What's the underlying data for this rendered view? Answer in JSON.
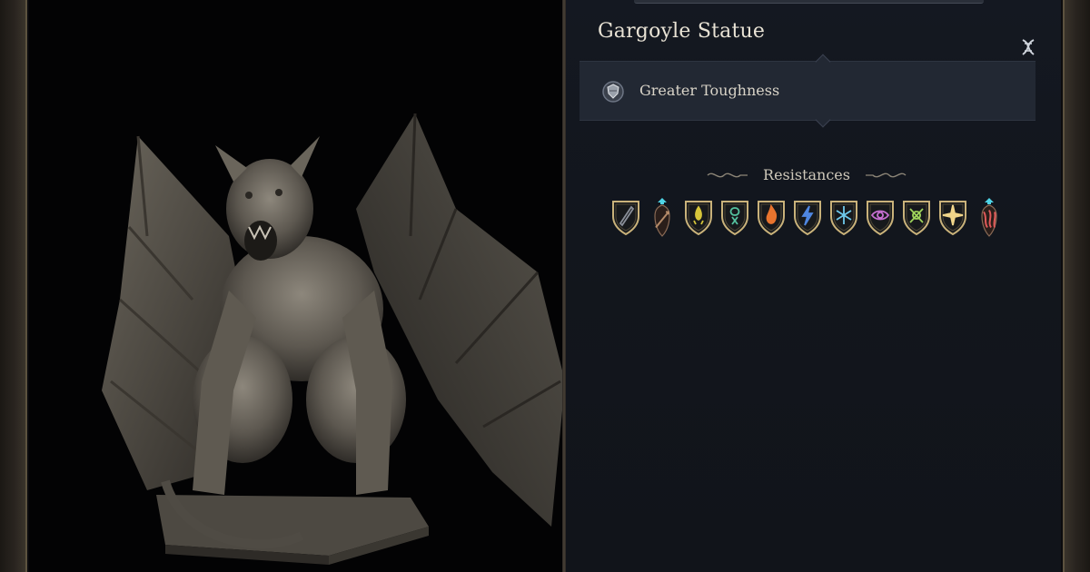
{
  "panel": {
    "title": "Gargoyle Statue",
    "examine_icon": "dna-icon",
    "passives": [
      {
        "label": "Greater Toughness",
        "icon": "shield-toughness-icon"
      }
    ]
  },
  "resistances": {
    "title": "Resistances",
    "items": [
      {
        "name": "slashing-icon",
        "state": "resistant",
        "color": "#8a8f99"
      },
      {
        "name": "piercing-icon",
        "state": "immune",
        "color": "#b48a68"
      },
      {
        "name": "acid-icon",
        "state": "resistant",
        "color": "#d6c53a"
      },
      {
        "name": "poison-icon",
        "state": "resistant",
        "color": "#54c29f"
      },
      {
        "name": "fire-icon",
        "state": "resistant",
        "color": "#e8742e"
      },
      {
        "name": "lightning-icon",
        "state": "resistant",
        "color": "#4f86e0"
      },
      {
        "name": "cold-icon",
        "state": "resistant",
        "color": "#6ec9ec"
      },
      {
        "name": "psychic-icon",
        "state": "resistant",
        "color": "#c66fd0"
      },
      {
        "name": "necrotic-icon",
        "state": "resistant",
        "color": "#9ed35a"
      },
      {
        "name": "radiant-icon",
        "state": "resistant",
        "color": "#f0d58a"
      },
      {
        "name": "force-icon",
        "state": "immune",
        "color": "#e05a5a"
      }
    ]
  },
  "colors": {
    "accent_gold": "#c9b27a",
    "immune_glow": "#4fd4e6"
  }
}
